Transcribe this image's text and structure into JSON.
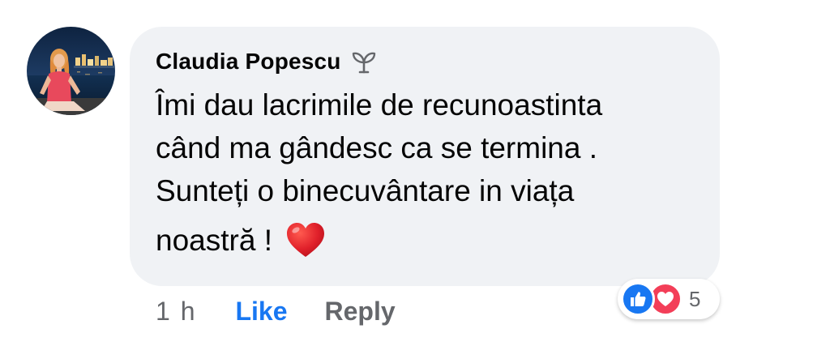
{
  "comment": {
    "author": "Claudia Popescu",
    "author_badge_icon": "sprout-icon",
    "avatar_icon": "profile-photo-avatar",
    "text_lines": [
      "Îmi dau lacrimile de recunoastinta",
      "când ma gândesc ca se termina .",
      "Sunteți o binecuvântare in viața",
      "noastră !"
    ],
    "emoji_icon": "red-heart-icon",
    "bubble_color": "#f0f2f5"
  },
  "actions": {
    "time": "1 h",
    "like_label": "Like",
    "reply_label": "Reply",
    "like_color": "#1877f2",
    "reply_color": "#65676b"
  },
  "reactions": {
    "icons": [
      "like-reaction-icon",
      "love-reaction-icon"
    ],
    "count": "5",
    "like_color": "#1877f2",
    "love_color": "#f33e58"
  }
}
